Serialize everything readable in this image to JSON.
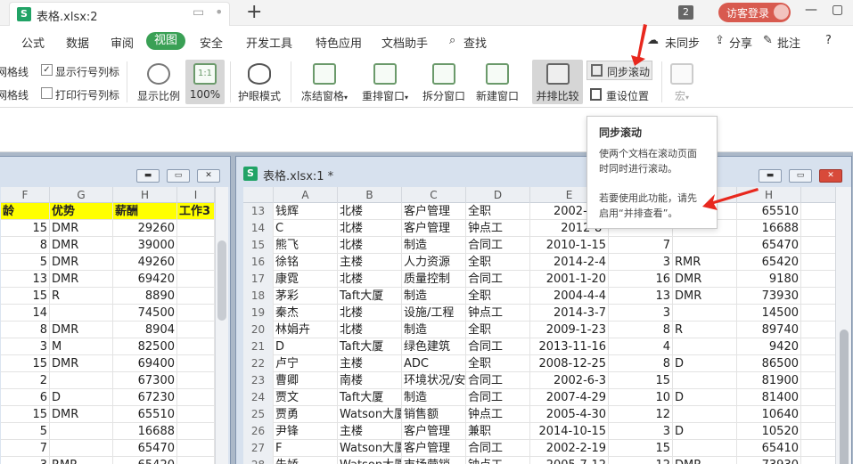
{
  "titlebar": {
    "doc_tab": "表格.xlsx:2",
    "badge": "2",
    "login_button": "访客登录"
  },
  "menu": {
    "items": [
      "公式",
      "数据",
      "审阅",
      "视图",
      "安全",
      "开发工具",
      "特色应用",
      "文档助手",
      "查找"
    ],
    "active": "视图",
    "sync": "未同步",
    "share": "分享",
    "annotate": "批注",
    "help": "?"
  },
  "ribbon": {
    "cb_gridlines_label": "网格线",
    "cb_show_rowcol": "显示行号列标",
    "cb_print_gridlines_label": "网格线",
    "cb_print_rowcol": "打印行号列标",
    "zoom_ratio": "显示比例",
    "zoom_100": "100%",
    "zoom_100_icon": "1:1",
    "eye_mode": "护眼模式",
    "freeze": "冻结窗格",
    "rearrange": "重排窗口",
    "split": "拆分窗口",
    "new_window": "新建窗口",
    "side_by_side": "并排比较",
    "sync_scroll": "同步滚动",
    "reset_position": "重设位置",
    "macro": "宏"
  },
  "tooltip": {
    "title": "同步滚动",
    "line1": "使两个文档在滚动页面",
    "line2": "时同时进行滚动。",
    "line3": "若要使用此功能，请先",
    "line4": "启用“并排查看”。"
  },
  "left_window": {
    "headers": [
      "F",
      "G",
      "H",
      "I"
    ],
    "header_labels": [
      "龄",
      "优势",
      "薪酬",
      "工作3"
    ],
    "rows": [
      [
        "15",
        "DMR",
        "29260"
      ],
      [
        "8",
        "DMR",
        "39000"
      ],
      [
        "5",
        "DMR",
        "49260"
      ],
      [
        "13",
        "DMR",
        "69420"
      ],
      [
        "15",
        "R",
        "8890"
      ],
      [
        "14",
        "",
        "74500"
      ],
      [
        "8",
        "DMR",
        "8904"
      ],
      [
        "3",
        "M",
        "82500"
      ],
      [
        "15",
        "DMR",
        "69400"
      ],
      [
        "2",
        "",
        "67300"
      ],
      [
        "6",
        "D",
        "67230"
      ],
      [
        "15",
        "DMR",
        "65510"
      ],
      [
        "5",
        "",
        "16688"
      ],
      [
        "7",
        "",
        "65470"
      ],
      [
        "3",
        "RMR",
        "65420"
      ]
    ]
  },
  "right_window": {
    "title": "表格.xlsx:1 *",
    "headers": [
      "A",
      "B",
      "C",
      "D",
      "E",
      "F",
      "G",
      "H"
    ],
    "rows": [
      [
        "13",
        "钱辉",
        "北楼",
        "客户管理",
        "全职",
        "2002-10-",
        "",
        "",
        "65510"
      ],
      [
        "14",
        "C",
        "北楼",
        "客户管理",
        "钟点工",
        "2012-8-",
        "",
        "",
        "16688"
      ],
      [
        "15",
        "熊飞",
        "北楼",
        "制造",
        "合同工",
        "2010-1-15",
        "7",
        "",
        "65470"
      ],
      [
        "16",
        "徐铭",
        "主楼",
        "人力资源",
        "全职",
        "2014-2-4",
        "3",
        "RMR",
        "65420"
      ],
      [
        "17",
        "康霓",
        "北楼",
        "质量控制",
        "合同工",
        "2001-1-20",
        "16",
        "DMR",
        "9180"
      ],
      [
        "18",
        "茅彩",
        "Taft大厦",
        "制造",
        "全职",
        "2004-4-4",
        "13",
        "DMR",
        "73930"
      ],
      [
        "19",
        "秦杰",
        "北楼",
        "设施/工程",
        "钟点工",
        "2014-3-7",
        "3",
        "",
        "14500"
      ],
      [
        "20",
        "林娟卉",
        "北楼",
        "制造",
        "全职",
        "2009-1-23",
        "8",
        "R",
        "89740"
      ],
      [
        "21",
        "D",
        "Taft大厦",
        "绿色建筑",
        "合同工",
        "2013-11-16",
        "4",
        "",
        "9420"
      ],
      [
        "22",
        "卢宁",
        "主楼",
        "ADC",
        "全职",
        "2008-12-25",
        "8",
        "D",
        "86500"
      ],
      [
        "23",
        "曹卿",
        "南楼",
        "环境状况/安",
        "合同工",
        "2002-6-3",
        "15",
        "",
        "81900"
      ],
      [
        "24",
        "贾文",
        "Taft大厦",
        "制造",
        "合同工",
        "2007-4-29",
        "10",
        "D",
        "81400"
      ],
      [
        "25",
        "贾勇",
        "Watson大厦",
        "销售额",
        "钟点工",
        "2005-4-30",
        "12",
        "",
        "10640"
      ],
      [
        "26",
        "尹锋",
        "主楼",
        "客户管理",
        "兼职",
        "2014-10-15",
        "3",
        "D",
        "10520"
      ],
      [
        "27",
        "F",
        "Watson大厦",
        "客户管理",
        "合同工",
        "2002-2-19",
        "15",
        "",
        "65410"
      ],
      [
        "28",
        "朱娇",
        "Watson大厦",
        "市场营销",
        "钟点工",
        "2005-7-12",
        "12",
        "DMR",
        "73930"
      ]
    ]
  },
  "colors": {
    "accent_green": "#21a366",
    "active_tab_bg": "#3aa055",
    "login_red": "#d85a4f",
    "header_yellow": "#ffff00",
    "annotation_red": "#e8281e"
  }
}
